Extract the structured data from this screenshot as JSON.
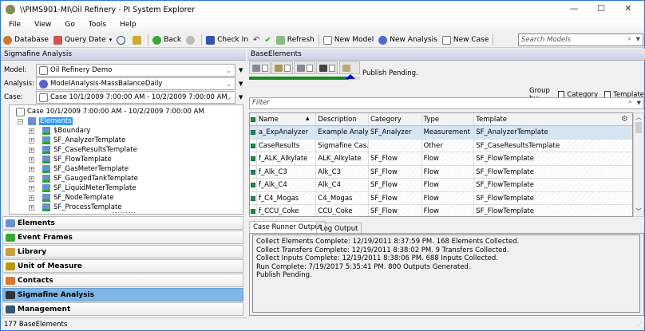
{
  "window": {
    "title": "\\\\PIMS901-MI\\Oil Refinery - PI System Explorer",
    "minimize": "—",
    "maximize": "☐",
    "close": "✕"
  },
  "menu": [
    "File",
    "View",
    "Go",
    "Tools",
    "Help"
  ],
  "toolbar": {
    "database": "Database",
    "query_date": "Query Date",
    "back": "Back",
    "check_in": "Check In",
    "refresh": "Refresh",
    "new_model": "New Model",
    "new_analysis": "New Analysis",
    "new_case": "New Case",
    "search_placeholder": "Search Models"
  },
  "left": {
    "header": "Sigmafine Analysis",
    "model_label": "Model:",
    "model_value": "Oil Refinery Demo",
    "analysis_label": "Analysis:",
    "analysis_value": "ModelAnalysis-MassBalanceDaily",
    "case_label": "Case:",
    "case_value": "Case 10/1/2009 7:00:00 AM - 10/2/2009 7:00:00 AM",
    "tree": {
      "root": "Case 10/1/2009 7:00:00 AM - 10/2/2009 7:00:00 AM",
      "elements": "Elements",
      "children": [
        "$Boundary",
        "SF_AnalyzerTemplate",
        "SF_CaseResultsTemplate",
        "SF_FlowTemplate",
        "SF_GasMeterTemplate",
        "SF_GaugedTankTemplate",
        "SF_LiquidMeterTemplate",
        "SF_NodeTemplate",
        "SF_ProcessTemplate"
      ]
    },
    "nav": [
      "Elements",
      "Event Frames",
      "Library",
      "Unit of Measure",
      "Contacts",
      "Sigmafine Analysis",
      "Management"
    ],
    "active_nav": "Sigmafine Analysis",
    "status": "177 BaseElements"
  },
  "right": {
    "header": "BaseElements",
    "publish_status": "Publish Pending.",
    "progress_percent": 90,
    "group_by": "Group by:",
    "category": "Category",
    "template": "Template",
    "filter_placeholder": "Filter",
    "columns": [
      "Name",
      "Description",
      "Category",
      "Type",
      "Template"
    ],
    "rows": [
      [
        "a_ExpAnalyzer",
        "Example Analy…",
        "SF_Analyzer",
        "Measurement",
        "SF_AnalyzerTemplate"
      ],
      [
        "CaseResults",
        "Sigmafine Cas…",
        "",
        "Other",
        "SF_CaseResultsTemplate"
      ],
      [
        "f_ALK_Alkylate",
        "ALK_Alkylate",
        "SF_Flow",
        "Flow",
        "SF_FlowTemplate"
      ],
      [
        "f_Alk_C3",
        "Alk_C3",
        "SF_Flow",
        "Flow",
        "SF_FlowTemplate"
      ],
      [
        "f_Alk_C4",
        "Alk_C4",
        "SF_Flow",
        "Flow",
        "SF_FlowTemplate"
      ],
      [
        "f_C4_Mogas",
        "C4_Mogas",
        "SF_Flow",
        "Flow",
        "SF_FlowTemplate"
      ],
      [
        "f_CCU_Coke",
        "CCU_Coke",
        "SF_Flow",
        "Flow",
        "SF_FlowTemplate"
      ]
    ],
    "tabs": [
      "Case Runner Output",
      "Log Output"
    ],
    "output": [
      "Collect Elements Complete: 12/19/2011 8:37:59 PM. 168 Elements Collected.",
      "Collect Transfers Complete: 12/19/2011 8:38:02 PM. 9 Transfers Collected.",
      "Collect Inputs Complete: 12/19/2011 8:38:06 PM. 688 Inputs Collected.",
      "Run Complete: 7/19/2017 5:35:41 PM. 800 Outputs Generated.",
      "Publish Pending."
    ]
  },
  "colors": {
    "accent": "#2b79d0",
    "selected_nav": "#7fb8e8",
    "progress": "#1a8a1a",
    "tree_selection": "#3399ff"
  }
}
